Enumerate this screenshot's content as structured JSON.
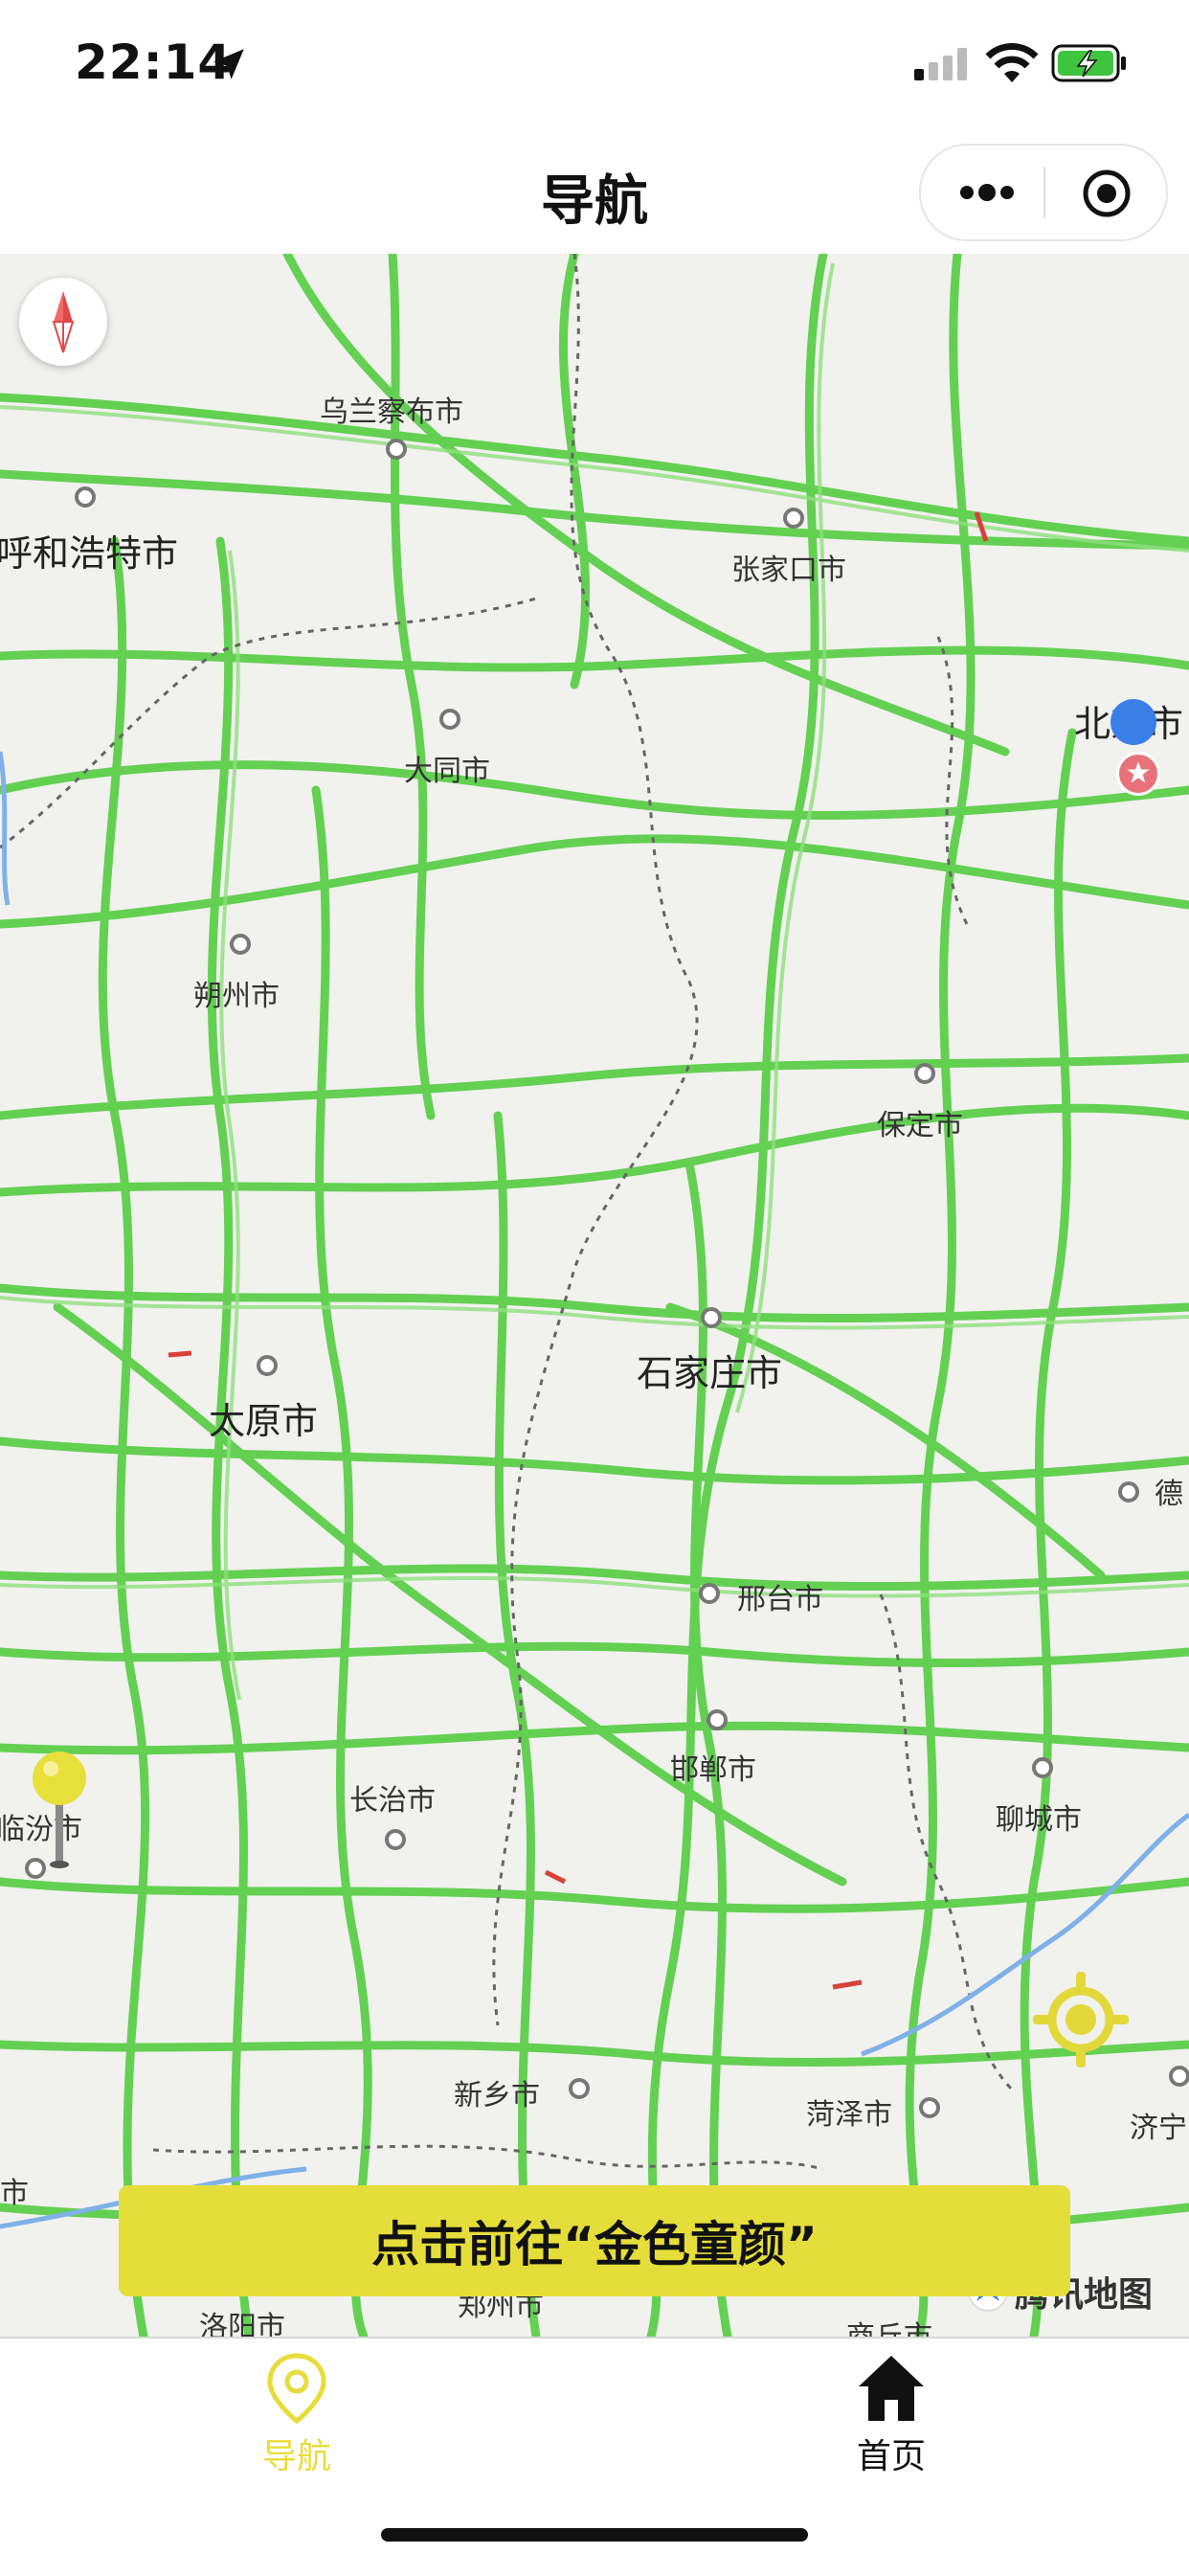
{
  "status_bar": {
    "time": "22:14"
  },
  "nav": {
    "title": "导航"
  },
  "map": {
    "cities": [
      {
        "name": "乌兰察布市"
      },
      {
        "name": "呼和浩特市"
      },
      {
        "name": "张家口市"
      },
      {
        "name": "北京市"
      },
      {
        "name": "大同市"
      },
      {
        "name": "朔州市"
      },
      {
        "name": "保定市"
      },
      {
        "name": "石家庄市"
      },
      {
        "name": "太原市"
      },
      {
        "name": "德"
      },
      {
        "name": "邢台市"
      },
      {
        "name": "邯郸市"
      },
      {
        "name": "长治市"
      },
      {
        "name": "临汾市"
      },
      {
        "name": "聊城市"
      },
      {
        "name": "新乡市"
      },
      {
        "name": "菏泽市"
      },
      {
        "name": "济宁"
      },
      {
        "name": "洛阳市"
      },
      {
        "name": "商丘市"
      },
      {
        "name": "市"
      },
      {
        "name": "郑州市"
      }
    ],
    "logo_text": "腾讯地图",
    "road_color": "#5ccf4a",
    "cta_label": "点击前往“金色童颜”"
  },
  "tabbar": {
    "items": [
      {
        "label": "导航",
        "icon": "location-pin-icon",
        "active": true,
        "color": "#e8dc3a"
      },
      {
        "label": "首页",
        "icon": "home-icon",
        "active": false
      }
    ]
  }
}
